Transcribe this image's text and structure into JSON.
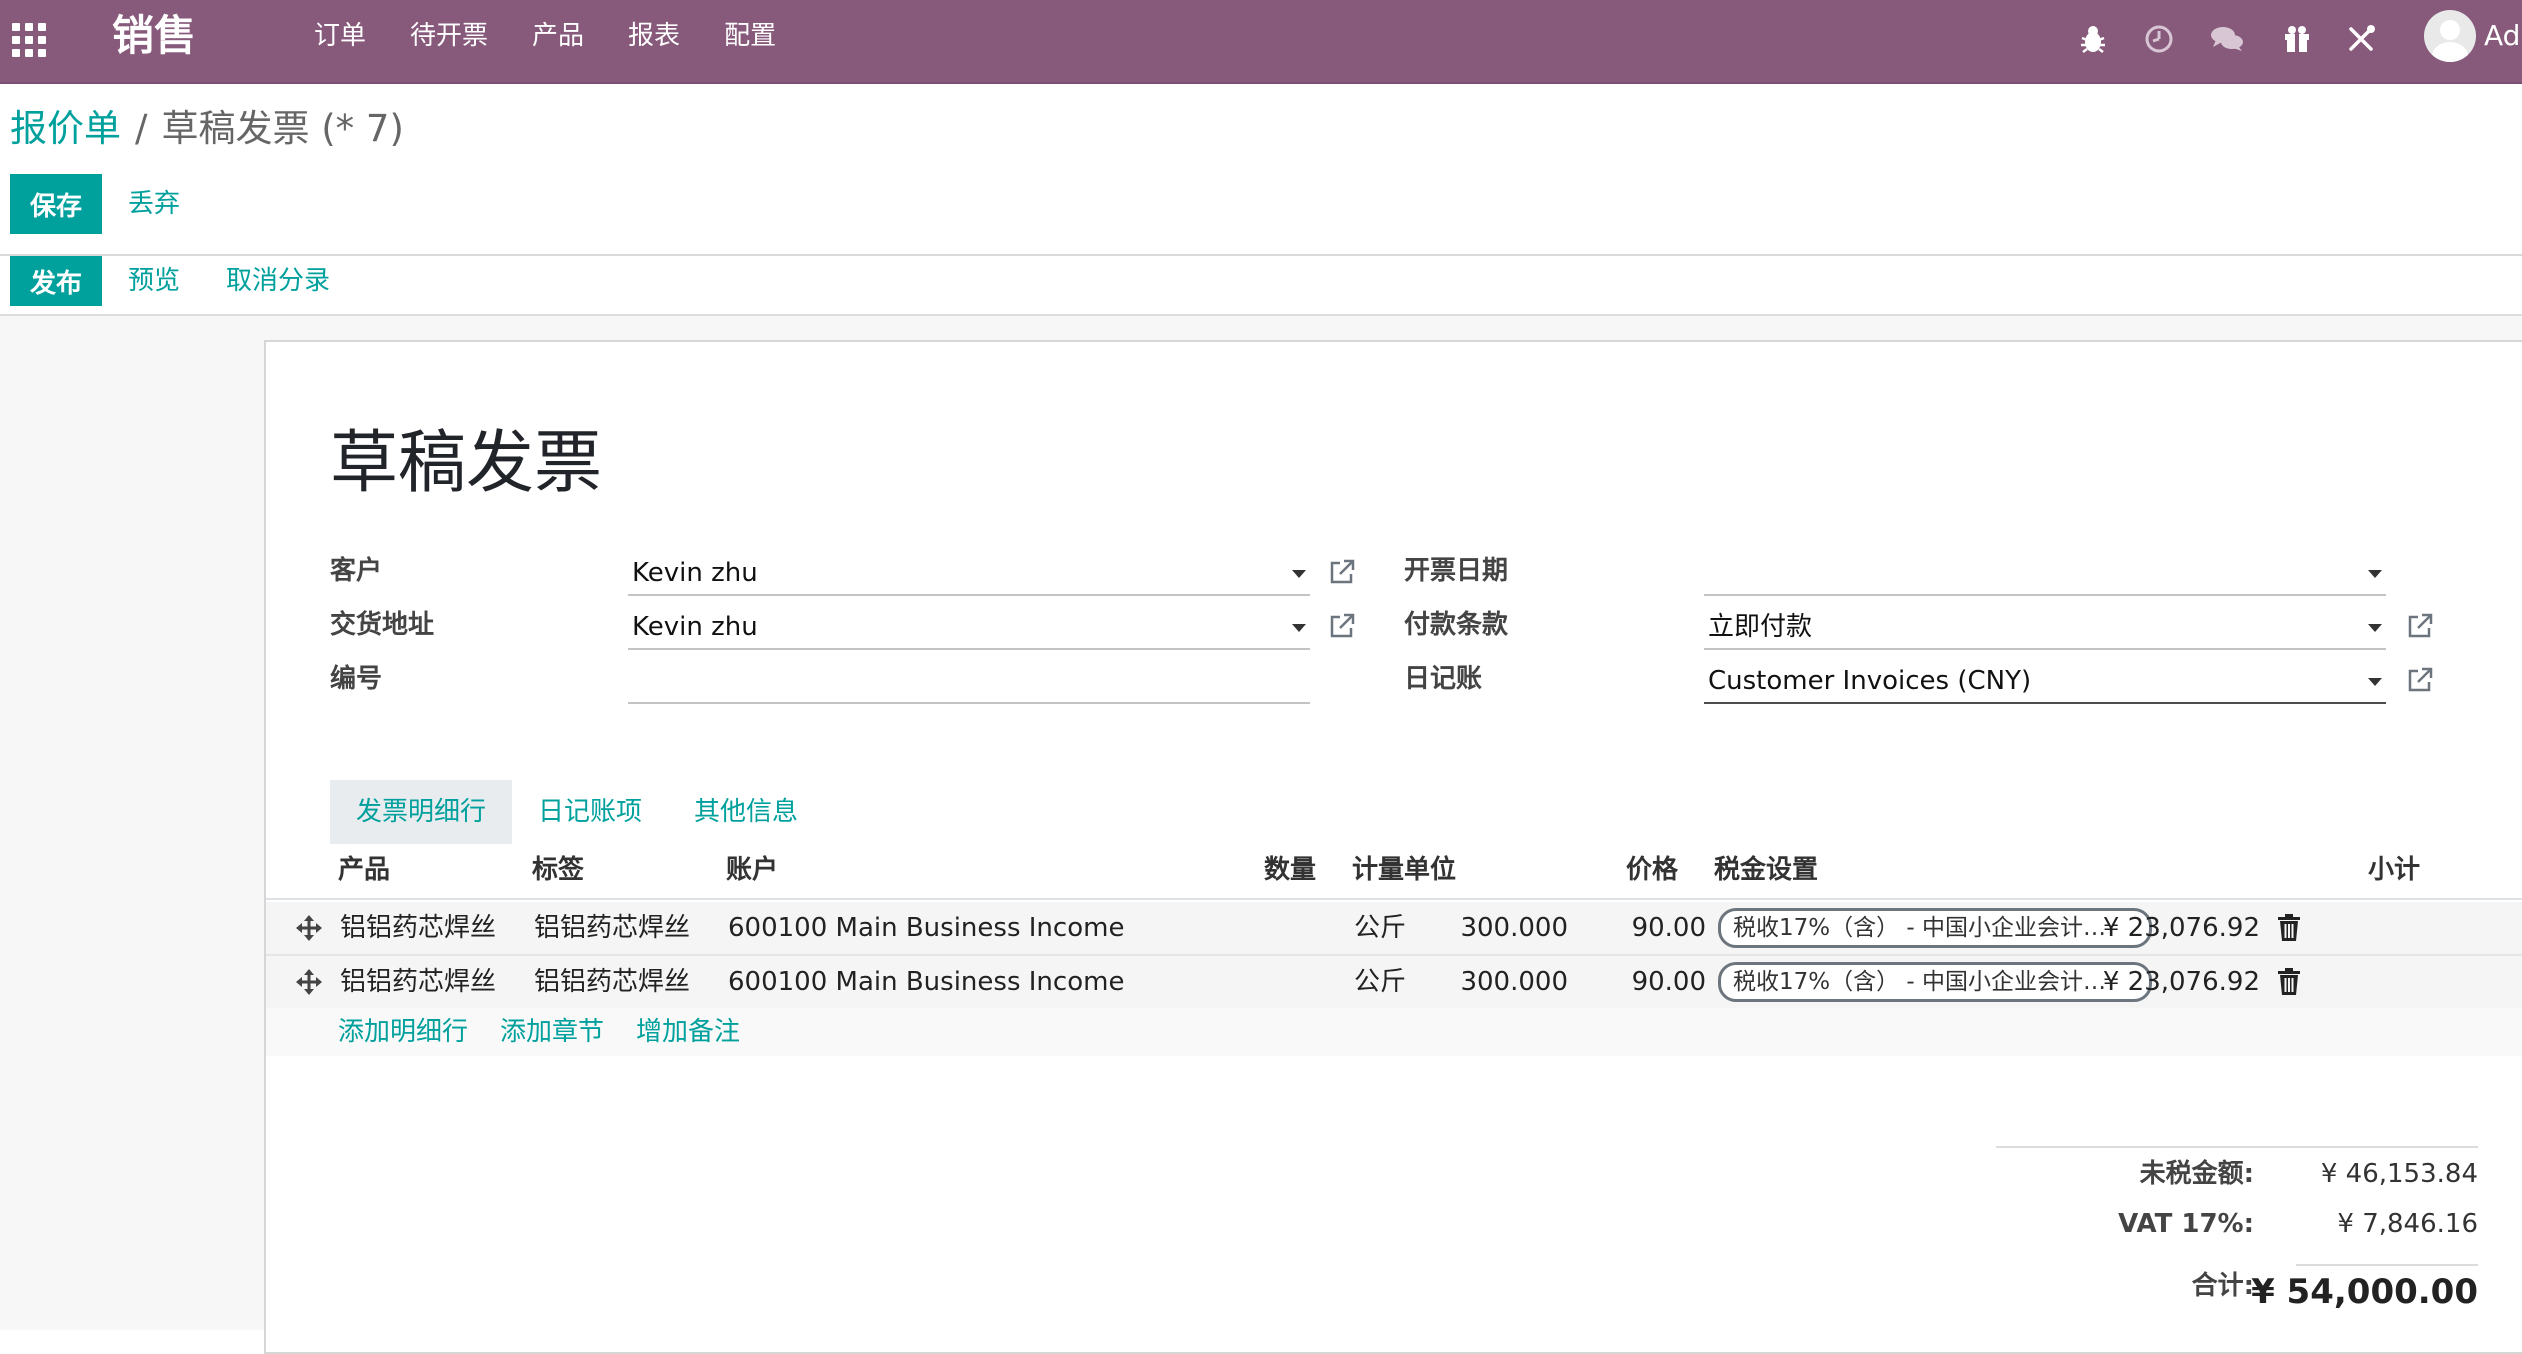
{
  "navbar": {
    "app_title": "销售",
    "menu": [
      "订单",
      "待开票",
      "产品",
      "报表",
      "配置"
    ],
    "icons": [
      "apps-grid-icon",
      "bug-icon",
      "clock-icon",
      "chat-icon",
      "gift-icon",
      "tools-icon"
    ],
    "user_name": "Adm",
    "bg_color": "#875a7b"
  },
  "breadcrumb": {
    "parent": "报价单",
    "separator": "/",
    "current": "草稿发票 (* 7)"
  },
  "actions": {
    "save": "保存",
    "discard": "丢弃",
    "post": "发布",
    "preview": "预览",
    "cancel_entry": "取消分录"
  },
  "form": {
    "title": "草稿发票",
    "customer_label": "客户",
    "customer_value": "Kevin zhu",
    "delivery_label": "交货地址",
    "delivery_value": "Kevin zhu",
    "ref_label": "编号",
    "ref_value": "",
    "invoice_date_label": "开票日期",
    "invoice_date_value": "",
    "payment_terms_label": "付款条款",
    "payment_terms_value": "立即付款",
    "journal_label": "日记账",
    "journal_value": "Customer Invoices (CNY)"
  },
  "tabs": [
    "发票明细行",
    "日记账项",
    "其他信息"
  ],
  "table": {
    "headers": {
      "product": "产品",
      "label": "标签",
      "account": "账户",
      "quantity": "数量",
      "uom": "计量单位",
      "price": "价格",
      "taxes": "税金设置",
      "subtotal": "小计"
    },
    "rows": [
      {
        "product": "铝铝药芯焊丝",
        "label": "铝铝药芯焊丝",
        "account": "600100 Main Business Income",
        "quantity": "300.000",
        "uom": "公斤",
        "price": "90.00",
        "tax": "税收17%（含） - 中国小企业会计…",
        "subtotal": "¥ 23,076.92"
      },
      {
        "product": "铝铝药芯焊丝",
        "label": "铝铝药芯焊丝",
        "account": "600100 Main Business Income",
        "quantity": "300.000",
        "uom": "公斤",
        "price": "90.00",
        "tax": "税收17%（含） - 中国小企业会计…",
        "subtotal": "¥ 23,076.92"
      }
    ],
    "add_line": "添加明细行",
    "add_section": "添加章节",
    "add_note": "增加备注"
  },
  "totals": {
    "untaxed_label": "未税金额:",
    "untaxed_value": "¥ 46,153.84",
    "vat_label": "VAT 17%:",
    "vat_value": "¥ 7,846.16",
    "total_label": "合计:",
    "total_value": "¥ 54,000.00"
  },
  "colors": {
    "brand": "#875a7b",
    "accent": "#00a09d"
  }
}
